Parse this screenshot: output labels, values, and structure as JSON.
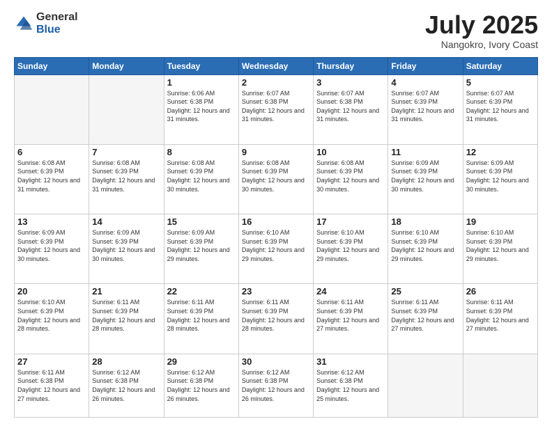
{
  "logo": {
    "general": "General",
    "blue": "Blue"
  },
  "header": {
    "month": "July 2025",
    "location": "Nangokro, Ivory Coast"
  },
  "weekdays": [
    "Sunday",
    "Monday",
    "Tuesday",
    "Wednesday",
    "Thursday",
    "Friday",
    "Saturday"
  ],
  "weeks": [
    [
      {
        "day": "",
        "info": ""
      },
      {
        "day": "",
        "info": ""
      },
      {
        "day": "1",
        "info": "Sunrise: 6:06 AM\nSunset: 6:38 PM\nDaylight: 12 hours and 31 minutes."
      },
      {
        "day": "2",
        "info": "Sunrise: 6:07 AM\nSunset: 6:38 PM\nDaylight: 12 hours and 31 minutes."
      },
      {
        "day": "3",
        "info": "Sunrise: 6:07 AM\nSunset: 6:38 PM\nDaylight: 12 hours and 31 minutes."
      },
      {
        "day": "4",
        "info": "Sunrise: 6:07 AM\nSunset: 6:39 PM\nDaylight: 12 hours and 31 minutes."
      },
      {
        "day": "5",
        "info": "Sunrise: 6:07 AM\nSunset: 6:39 PM\nDaylight: 12 hours and 31 minutes."
      }
    ],
    [
      {
        "day": "6",
        "info": "Sunrise: 6:08 AM\nSunset: 6:39 PM\nDaylight: 12 hours and 31 minutes."
      },
      {
        "day": "7",
        "info": "Sunrise: 6:08 AM\nSunset: 6:39 PM\nDaylight: 12 hours and 31 minutes."
      },
      {
        "day": "8",
        "info": "Sunrise: 6:08 AM\nSunset: 6:39 PM\nDaylight: 12 hours and 30 minutes."
      },
      {
        "day": "9",
        "info": "Sunrise: 6:08 AM\nSunset: 6:39 PM\nDaylight: 12 hours and 30 minutes."
      },
      {
        "day": "10",
        "info": "Sunrise: 6:08 AM\nSunset: 6:39 PM\nDaylight: 12 hours and 30 minutes."
      },
      {
        "day": "11",
        "info": "Sunrise: 6:09 AM\nSunset: 6:39 PM\nDaylight: 12 hours and 30 minutes."
      },
      {
        "day": "12",
        "info": "Sunrise: 6:09 AM\nSunset: 6:39 PM\nDaylight: 12 hours and 30 minutes."
      }
    ],
    [
      {
        "day": "13",
        "info": "Sunrise: 6:09 AM\nSunset: 6:39 PM\nDaylight: 12 hours and 30 minutes."
      },
      {
        "day": "14",
        "info": "Sunrise: 6:09 AM\nSunset: 6:39 PM\nDaylight: 12 hours and 30 minutes."
      },
      {
        "day": "15",
        "info": "Sunrise: 6:09 AM\nSunset: 6:39 PM\nDaylight: 12 hours and 29 minutes."
      },
      {
        "day": "16",
        "info": "Sunrise: 6:10 AM\nSunset: 6:39 PM\nDaylight: 12 hours and 29 minutes."
      },
      {
        "day": "17",
        "info": "Sunrise: 6:10 AM\nSunset: 6:39 PM\nDaylight: 12 hours and 29 minutes."
      },
      {
        "day": "18",
        "info": "Sunrise: 6:10 AM\nSunset: 6:39 PM\nDaylight: 12 hours and 29 minutes."
      },
      {
        "day": "19",
        "info": "Sunrise: 6:10 AM\nSunset: 6:39 PM\nDaylight: 12 hours and 29 minutes."
      }
    ],
    [
      {
        "day": "20",
        "info": "Sunrise: 6:10 AM\nSunset: 6:39 PM\nDaylight: 12 hours and 28 minutes."
      },
      {
        "day": "21",
        "info": "Sunrise: 6:11 AM\nSunset: 6:39 PM\nDaylight: 12 hours and 28 minutes."
      },
      {
        "day": "22",
        "info": "Sunrise: 6:11 AM\nSunset: 6:39 PM\nDaylight: 12 hours and 28 minutes."
      },
      {
        "day": "23",
        "info": "Sunrise: 6:11 AM\nSunset: 6:39 PM\nDaylight: 12 hours and 28 minutes."
      },
      {
        "day": "24",
        "info": "Sunrise: 6:11 AM\nSunset: 6:39 PM\nDaylight: 12 hours and 27 minutes."
      },
      {
        "day": "25",
        "info": "Sunrise: 6:11 AM\nSunset: 6:39 PM\nDaylight: 12 hours and 27 minutes."
      },
      {
        "day": "26",
        "info": "Sunrise: 6:11 AM\nSunset: 6:39 PM\nDaylight: 12 hours and 27 minutes."
      }
    ],
    [
      {
        "day": "27",
        "info": "Sunrise: 6:11 AM\nSunset: 6:38 PM\nDaylight: 12 hours and 27 minutes."
      },
      {
        "day": "28",
        "info": "Sunrise: 6:12 AM\nSunset: 6:38 PM\nDaylight: 12 hours and 26 minutes."
      },
      {
        "day": "29",
        "info": "Sunrise: 6:12 AM\nSunset: 6:38 PM\nDaylight: 12 hours and 26 minutes."
      },
      {
        "day": "30",
        "info": "Sunrise: 6:12 AM\nSunset: 6:38 PM\nDaylight: 12 hours and 26 minutes."
      },
      {
        "day": "31",
        "info": "Sunrise: 6:12 AM\nSunset: 6:38 PM\nDaylight: 12 hours and 25 minutes."
      },
      {
        "day": "",
        "info": ""
      },
      {
        "day": "",
        "info": ""
      }
    ]
  ]
}
